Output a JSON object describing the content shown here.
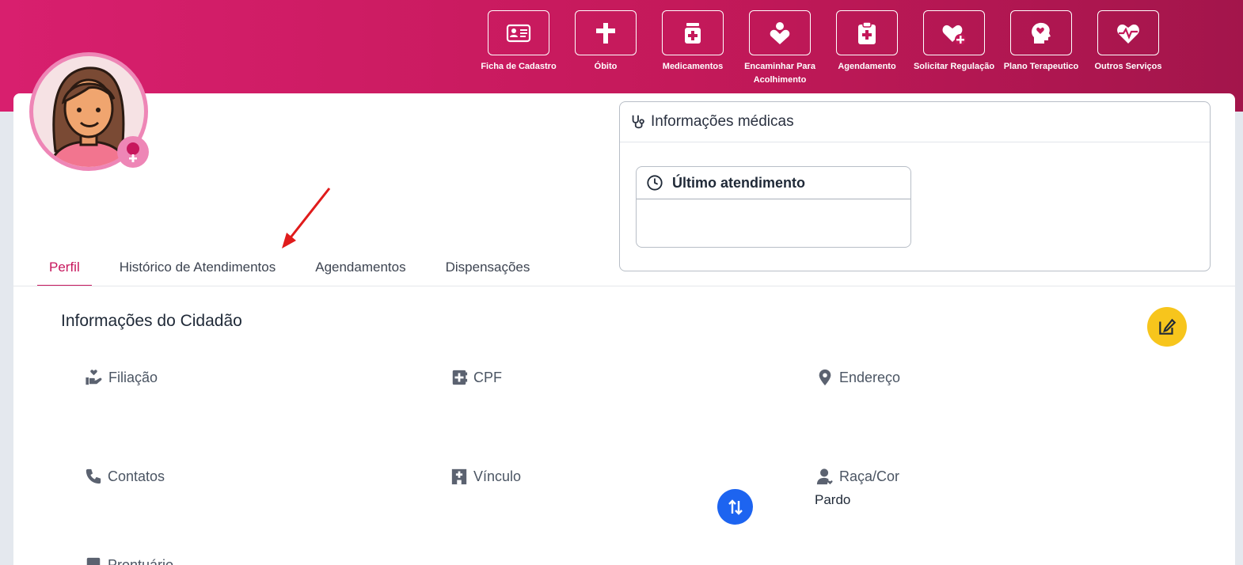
{
  "actions": [
    {
      "label": "Ficha de Cadastro",
      "icon": "id-card-icon"
    },
    {
      "label": "Óbito",
      "icon": "cross-icon"
    },
    {
      "label": "Medicamentos",
      "icon": "medicine-bottle-icon"
    },
    {
      "label": "Encaminhar Para Acolhimento",
      "icon": "person-heart-icon"
    },
    {
      "label": "Agendamento",
      "icon": "medical-clipboard-icon"
    },
    {
      "label": "Solicitar Regulação",
      "icon": "heart-plus-icon"
    },
    {
      "label": "Plano Terapeutico",
      "icon": "head-heart-icon"
    },
    {
      "label": "Outros Serviços",
      "icon": "heartbeat-icon"
    }
  ],
  "tabs": [
    {
      "label": "Perfil",
      "active": true
    },
    {
      "label": "Histórico de Atendimentos",
      "active": false
    },
    {
      "label": "Agendamentos",
      "active": false
    },
    {
      "label": "Dispensações",
      "active": false
    }
  ],
  "medical_info": {
    "title": "Informações médicas",
    "last_visit": {
      "title": "Último atendimento"
    }
  },
  "citizen": {
    "title": "Informações do Cidadão",
    "fields": [
      {
        "label": "Filiação",
        "value": "",
        "icon": "hand-heart-icon"
      },
      {
        "label": "CPF",
        "value": "",
        "icon": "contact-book-icon"
      },
      {
        "label": "Endereço",
        "value": "",
        "icon": "location-pin-icon"
      },
      {
        "label": "Contatos",
        "value": "",
        "icon": "phone-icon"
      },
      {
        "label": "Vínculo",
        "value": "",
        "icon": "hospital-icon"
      },
      {
        "label": "Raça/Cor",
        "value": "Pardo",
        "icon": "person-icon"
      }
    ],
    "partial_field_label": "Prontuário"
  },
  "colors": {
    "brand": "#c7175d",
    "edit_button": "#f7c51c",
    "fab": "#1d64f0",
    "annotation_arrow": "#e01b1b"
  }
}
